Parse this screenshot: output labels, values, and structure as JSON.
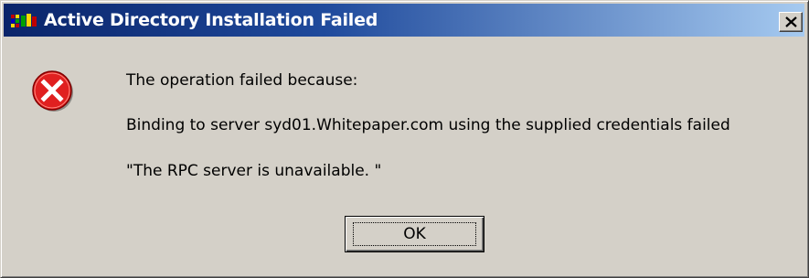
{
  "window": {
    "title": "Active Directory Installation Failed",
    "close_label": "X"
  },
  "message": {
    "line1": "The operation failed because:",
    "line2": "Binding to server syd01.Whitepaper.com using the supplied credentials failed",
    "line3": "\"The RPC server is unavailable. \""
  },
  "buttons": {
    "ok_label": "OK"
  },
  "icons": {
    "app": "active-directory-icon",
    "error": "error-icon",
    "close": "close-icon"
  },
  "colors": {
    "dialog_face": "#d4d0c8",
    "titlebar_start": "#0a246a",
    "titlebar_end": "#a6caf0",
    "error_red": "#e02020"
  }
}
